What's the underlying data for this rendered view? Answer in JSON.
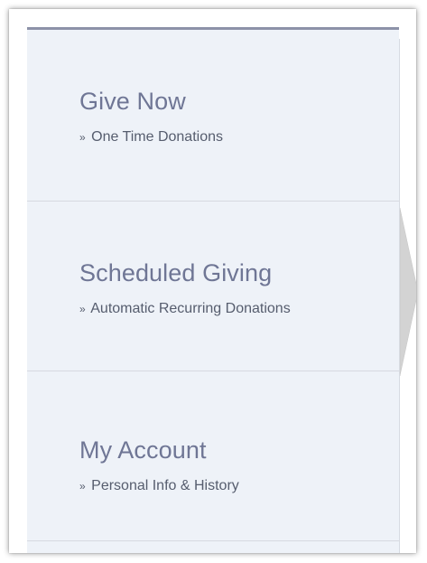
{
  "menu": {
    "items": [
      {
        "title": "Give Now",
        "prefix": "»",
        "subtitle": "One Time Donations",
        "selected": false
      },
      {
        "title": "Scheduled Giving",
        "prefix": "»",
        "subtitle": "Automatic Recurring Donations",
        "selected": true
      },
      {
        "title": "My Account",
        "prefix": "»",
        "subtitle": "Personal Info & History",
        "selected": false
      }
    ]
  },
  "colors": {
    "menu_background": "#eef2f8",
    "title_text": "#6f7695",
    "subtitle_text": "#565d6e",
    "top_border": "#8d92a8",
    "selected_arrow": "#d3d3d3"
  },
  "icons": {
    "selected_indicator": "triangle-right-arrow"
  }
}
